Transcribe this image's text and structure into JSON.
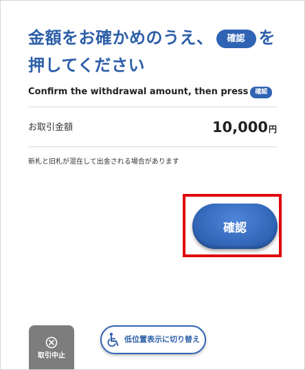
{
  "heading": {
    "text_before": "金額をお確かめのうえ、",
    "pill": "確認",
    "text_after": "を押してください"
  },
  "subheading": {
    "text": "Confirm the withdrawal amount, then press",
    "pill": "確認"
  },
  "transaction": {
    "label": "お取引金額",
    "amount": "10,000",
    "unit": "円"
  },
  "note": "新札と旧札が混在して出金される場合があります",
  "buttons": {
    "confirm": "確認",
    "cancel": "取引中止",
    "low_position": "低位置表示に切り替え"
  },
  "icons": {
    "cancel": "close-circle-icon",
    "low_position": "wheelchair-icon"
  },
  "colors": {
    "accent": "#2f63b4",
    "heading": "#2c5ea8",
    "highlight": "#e0000b",
    "cancel_bg": "#7d7d7d"
  }
}
